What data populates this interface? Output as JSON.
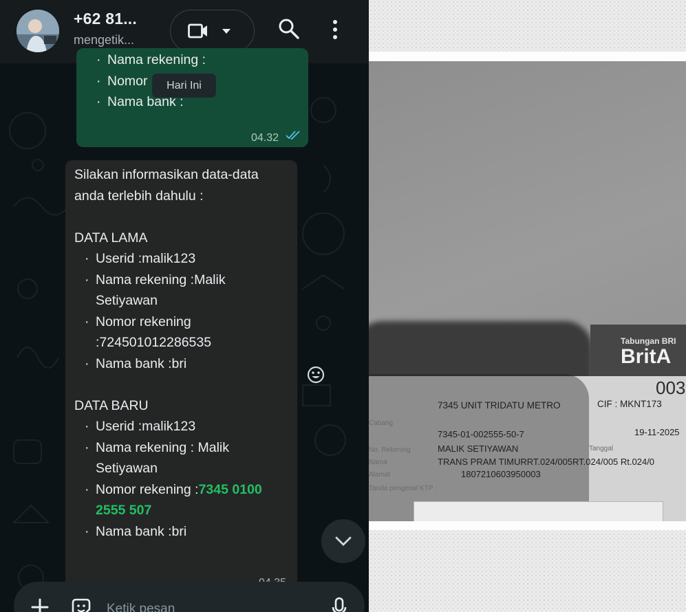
{
  "header": {
    "contact_name": "+62 81...",
    "status": "mengetik..."
  },
  "date_chip": "Hari Ini",
  "outgoing": {
    "items": [
      "Nama rekening :",
      "Nomor rekening :",
      "Nama bank :"
    ],
    "time": "04.32"
  },
  "incoming": {
    "intro_1": "Silakan informasikan data-data",
    "intro_2": "anda terlebih dahulu :",
    "old_title": "DATA LAMA",
    "old_userid": "Userid :malik123",
    "old_name_1": "Nama rekening :Malik",
    "old_name_2": "Setiyawan",
    "old_acc_1": "Nomor rekening",
    "old_acc_2": ":724501012286535",
    "old_bank": "Nama bank :bri",
    "new_title": "DATA BARU",
    "new_userid": "Userid :malik123",
    "new_name_1": "Nama rekening : Malik",
    "new_name_2": "Setiyawan",
    "new_acc_label": "Nomor rekening :",
    "new_acc_hl_1": "7345 0100",
    "new_acc_hl_2": "2555 507",
    "new_bank": "Nama bank :bri",
    "time": "04.35"
  },
  "composer": {
    "placeholder": "Ketik pesan"
  },
  "photo": {
    "bank_type": "Tabungan BRI",
    "brand": "BritA",
    "card_number": "003",
    "branch_line": "7345 UNIT TRIDATU METRO",
    "cif": "CIF : MKNT173",
    "label_cabang": "Cabang",
    "account_no": "7345-01-002555-50-7",
    "date": "19-11-2025",
    "label_no_rekening": "No. Rekening",
    "name": "MALIK SETIYAWAN",
    "label_tanggal": "Tanggal",
    "label_nama": "Nama",
    "address": "TRANS PRAM TIMURRT.024/005RT.024/005 Rt.024/0",
    "label_alamat": "Alamat",
    "ktp": "1807210603950003",
    "label_ktp": "Tanda pengenal KTP :"
  },
  "colors": {
    "chat_bg": "#0c1317",
    "header_bg": "#161b1e",
    "outgoing_bubble": "#144d37",
    "incoming_bubble": "#242626",
    "highlight": "#21c063",
    "read_ticks": "#53bdeb"
  },
  "icons": [
    "avatar",
    "video-icon",
    "chevron-down-icon",
    "search-icon",
    "more-vertical-icon",
    "double-check-icon",
    "emoji-icon",
    "plus-icon",
    "sticker-icon",
    "mic-icon"
  ]
}
